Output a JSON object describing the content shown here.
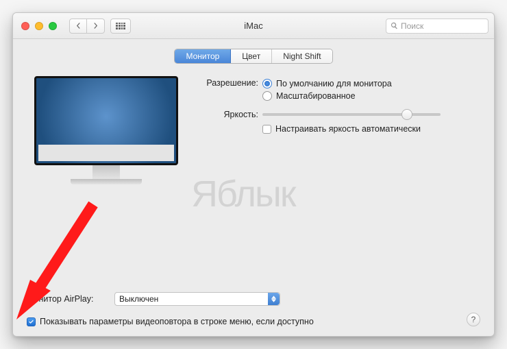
{
  "window": {
    "title": "iMac"
  },
  "toolbar": {
    "search_placeholder": "Поиск"
  },
  "tabs": {
    "items": [
      "Монитор",
      "Цвет",
      "Night Shift"
    ],
    "active_index": 0
  },
  "resolution": {
    "label": "Разрешение:",
    "options": [
      "По умолчанию для монитора",
      "Масштабированное"
    ],
    "selected_index": 0
  },
  "brightness": {
    "label": "Яркость:",
    "auto_label": "Настраивать яркость автоматически",
    "auto_checked": false,
    "value_percent": 81
  },
  "airplay": {
    "label": "Монитор AirPlay:",
    "selected": "Выключен"
  },
  "footer": {
    "show_mirroring_label": "Показывать параметры видеоповтора в строке меню, если доступно",
    "show_mirroring_checked": true
  },
  "watermark": "Яблык"
}
